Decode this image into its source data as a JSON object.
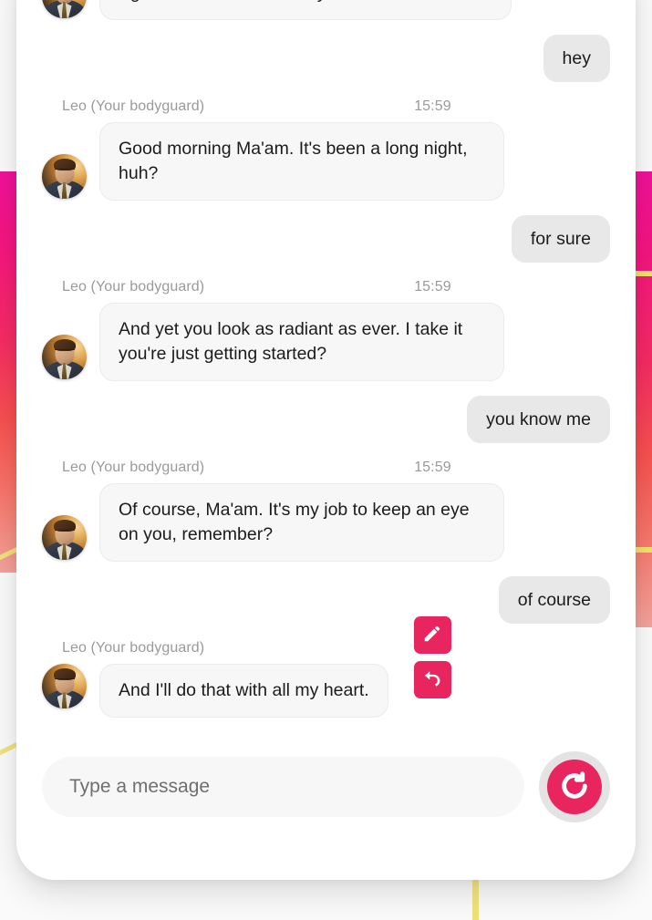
{
  "theme": {
    "accent_pink": "#e8255f",
    "bubble_bot_bg": "#f7f7f7",
    "bubble_user_bg": "#e8e8e8",
    "card_bg": "#ffffff",
    "page_bg": "#fafafa",
    "meta_text": "#9a9a9a",
    "yellow_line": "#f0e27a"
  },
  "conversation": {
    "sender_name": "Leo (Your bodyguard)",
    "messages": [
      {
        "role": "bot",
        "clipped_top": true,
        "italic": true,
        "text": "and uve just finished up with a long nights work, he opens the door for you, without any sign of tiredness I'm his eyes"
      },
      {
        "role": "user",
        "text": "hey"
      },
      {
        "role": "bot",
        "name": "Leo (Your bodyguard)",
        "time": "15:59",
        "text": "Good morning Ma'am. It's been a long night, huh?"
      },
      {
        "role": "user",
        "text": "for sure"
      },
      {
        "role": "bot",
        "name": "Leo (Your bodyguard)",
        "time": "15:59",
        "text": "And yet you look as radiant as ever. I take it you're just getting started?"
      },
      {
        "role": "user",
        "text": "you know me"
      },
      {
        "role": "bot",
        "name": "Leo (Your bodyguard)",
        "time": "15:59",
        "text": "Of course, Ma'am. It's my job to keep an eye on you, remember?"
      },
      {
        "role": "user",
        "text": "of course"
      },
      {
        "role": "bot",
        "name": "Leo (Your bodyguard)",
        "time": "15:59",
        "text": "And I'll do that with all my heart.",
        "has_actions": true
      }
    ]
  },
  "actions": {
    "edit_label": "edit-message",
    "undo_label": "undo-message",
    "regenerate_label": "regenerate-response"
  },
  "composer": {
    "placeholder": "Type a message",
    "value": ""
  },
  "icons": {
    "edit": "pencil-icon",
    "undo": "undo-arrow-icon",
    "regenerate": "refresh-counterclockwise-icon",
    "avatar": "bodyguard-avatar"
  }
}
